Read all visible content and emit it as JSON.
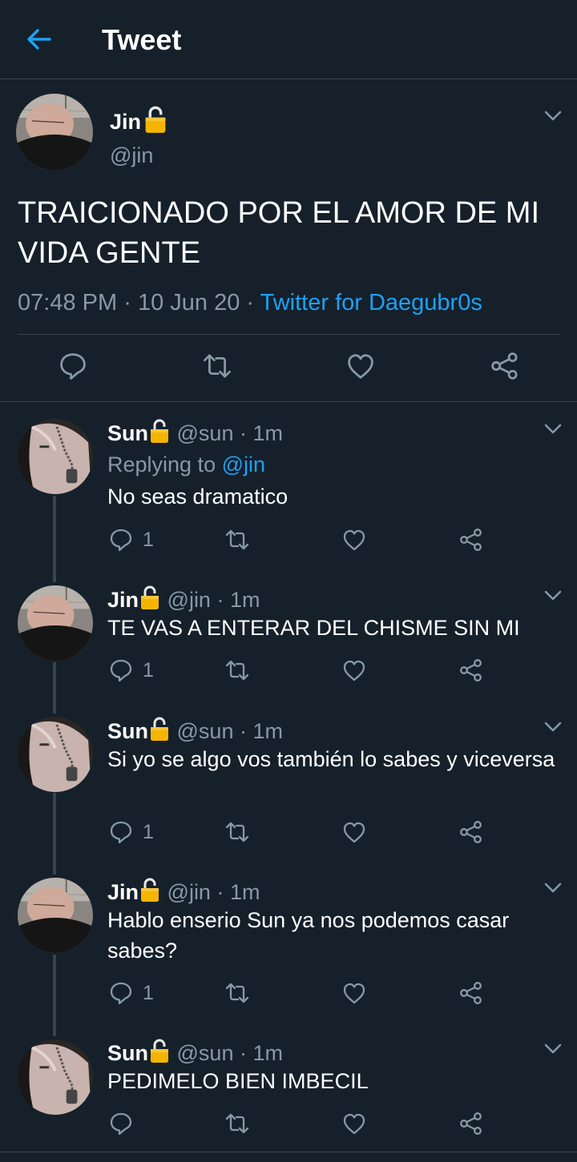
{
  "header": {
    "title": "Tweet"
  },
  "main_tweet": {
    "name": "Jin",
    "handle": "@jin",
    "text": "TRAICIONADO POR EL AMOR DE MI VIDA GENTE",
    "time": "07:48 PM",
    "date": "10 Jun 20",
    "source": "Twitter for Daegubr0s",
    "separator": "·",
    "icons": [
      "back-arrow-icon",
      "lock-icon",
      "chevron-down-icon",
      "reply-icon",
      "retweet-icon",
      "like-icon",
      "share-icon"
    ]
  },
  "replies": [
    {
      "name": "Sun",
      "handle": "@sun",
      "time": "· 1m",
      "replying_prefix": "Replying to",
      "replying_to": "@jin",
      "text": "No seas dramatico",
      "reply_count": "1"
    },
    {
      "name": "Jin",
      "handle": "@jin",
      "time": "· 1m",
      "text": "TE VAS A ENTERAR DEL CHISME SIN MI",
      "reply_count": "1"
    },
    {
      "name": "Sun",
      "handle": "@sun",
      "time": "· 1m",
      "text": "Si yo se algo vos también lo sabes y viceversa",
      "reply_count": "1"
    },
    {
      "name": "Jin",
      "handle": "@jin",
      "time": "· 1m",
      "text": "Hablo enserio Sun ya nos podemos casar sabes?",
      "reply_count": "1"
    },
    {
      "name": "Sun",
      "handle": "@sun",
      "time": "· 1m",
      "text": "PEDIMELO BIEN IMBECIL",
      "reply_count": ""
    }
  ],
  "colors": {
    "background": "#15202b",
    "divider": "#38444d",
    "muted": "#8899a6",
    "accent": "#1da1f2",
    "lock": "#f5b400"
  }
}
